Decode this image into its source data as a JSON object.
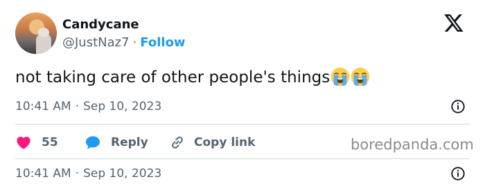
{
  "user": {
    "display_name": "Candycane",
    "handle": "@JustNaz7",
    "separator": "·",
    "follow_label": "Follow"
  },
  "tweet": {
    "text": "not taking care of other people's things",
    "emojis": [
      "loudly-crying-face-emoji",
      "loudly-crying-face-emoji"
    ],
    "time": "10:41 AM",
    "date_separator": "·",
    "date": "Sep 10, 2023"
  },
  "actions": {
    "like_count": "55",
    "reply_label": "Reply",
    "copy_link_label": "Copy link"
  },
  "watermark": "boredpanda.com",
  "footer": {
    "time": "10:41 AM",
    "date_separator": "·",
    "date": "Sep 10, 2023"
  },
  "icons": [
    "x-logo-icon",
    "info-icon",
    "heart-icon",
    "reply-bubble-icon",
    "link-icon"
  ],
  "colors": {
    "follow": "#1d9bf0",
    "like": "#f91880",
    "reply": "#1d9bf0",
    "secondary_text": "#536471",
    "divider": "#cfd9de"
  }
}
